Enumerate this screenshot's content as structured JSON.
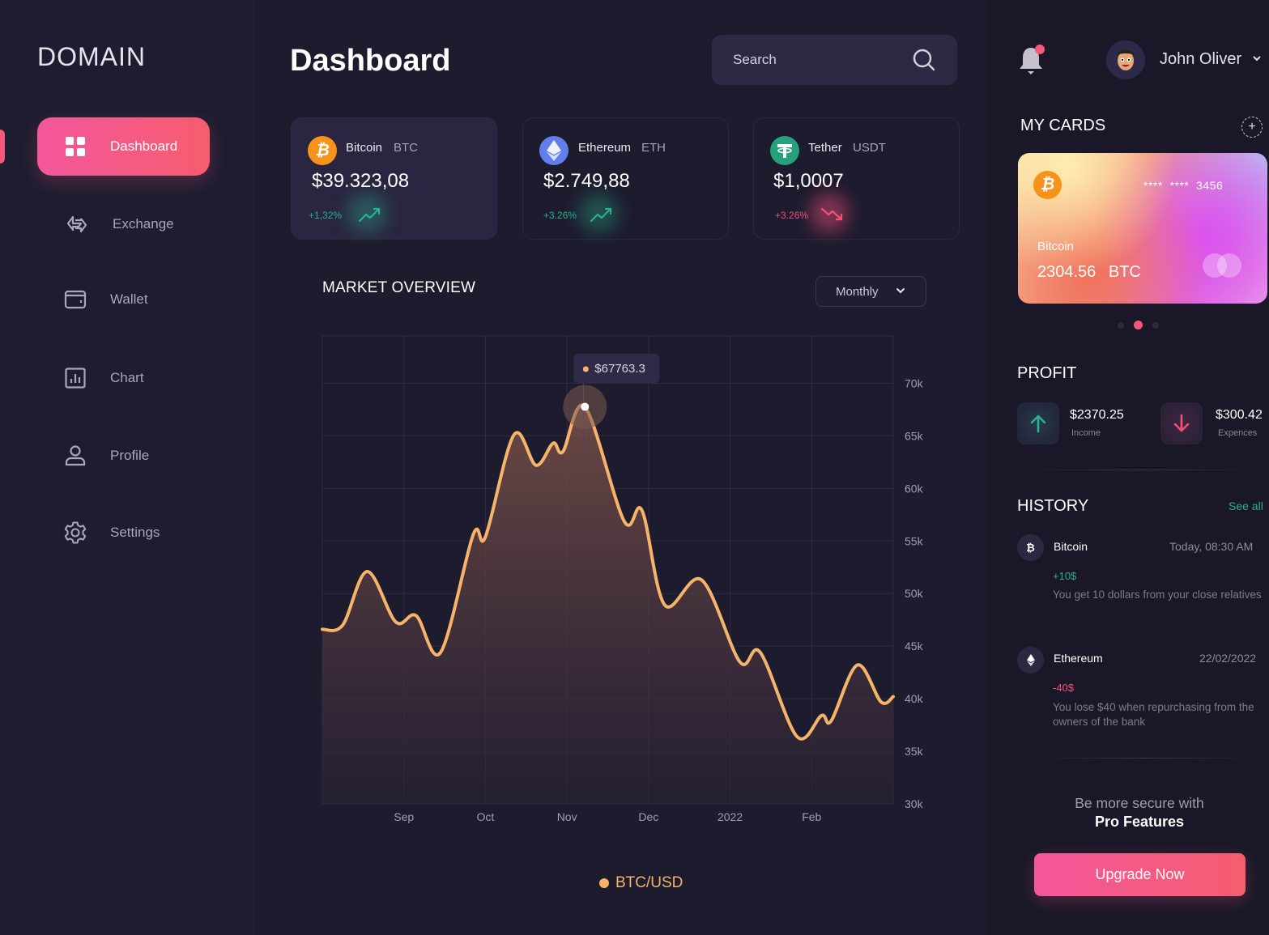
{
  "brand": {
    "logo_text": "DOMAIN"
  },
  "sidebar": {
    "items": [
      {
        "label": "Dashboard",
        "icon": "grid-icon",
        "active": true
      },
      {
        "label": "Exchange",
        "icon": "exchange-icon",
        "active": false
      },
      {
        "label": "Wallet",
        "icon": "wallet-icon",
        "active": false
      },
      {
        "label": "Chart",
        "icon": "bar-chart-icon",
        "active": false
      },
      {
        "label": "Profile",
        "icon": "user-icon",
        "active": false
      },
      {
        "label": "Settings",
        "icon": "gear-icon",
        "active": false
      }
    ]
  },
  "header": {
    "title": "Dashboard",
    "search_placeholder": "Search",
    "search_value": "",
    "notifications_unread": true,
    "user_name": "John Oliver"
  },
  "coins": [
    {
      "name": "Bitcoin",
      "symbol": "BTC",
      "price": "$39.323,08",
      "change": "+1,32%",
      "trend": "up",
      "icon": "bitcoin-icon",
      "color": "#f7931a"
    },
    {
      "name": "Ethereum",
      "symbol": "ETH",
      "price": "$2.749,88",
      "change": "+3.26%",
      "trend": "up",
      "icon": "ethereum-icon",
      "color": "#627eea"
    },
    {
      "name": "Tether",
      "symbol": "USDT",
      "price": "$1,0007",
      "change": "+3.26%",
      "trend": "down",
      "icon": "tether-icon",
      "color": "#26a17b"
    }
  ],
  "market": {
    "title": "MARKET OVERVIEW",
    "period": "Monthly",
    "tooltip": "$67763.3",
    "legend": "BTC/USD"
  },
  "chart_data": {
    "type": "area",
    "title": "MARKET OVERVIEW",
    "series": [
      {
        "name": "BTC/USD",
        "color": "#f5b46a",
        "points": [
          [
            0.0,
            46.6
          ],
          [
            0.25,
            47.0
          ],
          [
            0.55,
            52.1
          ],
          [
            0.9,
            47.3
          ],
          [
            1.15,
            47.9
          ],
          [
            1.45,
            44.4
          ],
          [
            1.85,
            55.6
          ],
          [
            2.0,
            55.4
          ],
          [
            2.35,
            65.1
          ],
          [
            2.62,
            62.2
          ],
          [
            2.83,
            64.3
          ],
          [
            2.95,
            63.5
          ],
          [
            3.22,
            67.76
          ],
          [
            3.7,
            56.9
          ],
          [
            3.92,
            57.9
          ],
          [
            4.2,
            48.9
          ],
          [
            4.65,
            51.3
          ],
          [
            5.12,
            43.5
          ],
          [
            5.37,
            44.4
          ],
          [
            5.82,
            36.4
          ],
          [
            6.12,
            38.4
          ],
          [
            6.24,
            37.9
          ],
          [
            6.56,
            43.2
          ],
          [
            6.85,
            39.7
          ],
          [
            7.0,
            40.2
          ]
        ]
      }
    ],
    "x_ticks": [
      "Sep",
      "Oct",
      "Nov",
      "Dec",
      "2022",
      "Feb"
    ],
    "x_tick_positions": [
      1,
      2,
      3,
      4,
      5,
      6
    ],
    "x_range": [
      0,
      7
    ],
    "y_ticks": [
      "30k",
      "35k",
      "40k",
      "45k",
      "50k",
      "55k",
      "60k",
      "65k",
      "70k"
    ],
    "y_tick_values": [
      30,
      35,
      40,
      45,
      50,
      55,
      60,
      65,
      70
    ],
    "ylim": [
      30,
      74.5
    ],
    "y_unit": "thousand USD",
    "grid": true,
    "legend": "bottom-center",
    "highlight": {
      "x": 3.22,
      "y": 67.76,
      "label": "$67763.3"
    }
  },
  "my_cards": {
    "title": "MY CARDS",
    "card": {
      "number_masked": "****  ****  3456",
      "coin": "Bitcoin",
      "balance": "2304.56",
      "unit": "BTC"
    },
    "pager": {
      "count": 3,
      "active": 1
    }
  },
  "profit": {
    "title": "PROFIT",
    "income": {
      "value": "$2370.25",
      "label": "Income"
    },
    "expenses": {
      "value": "$300.42",
      "label": "Expences"
    }
  },
  "history": {
    "title": "HISTORY",
    "see_all": "See all",
    "items": [
      {
        "coin": "Bitcoin",
        "date": "Today, 08:30 AM",
        "amount": "+10$",
        "positive": true,
        "description": "You get 10 dollars from your close relatives"
      },
      {
        "coin": "Ethereum",
        "date": "22/02/2022",
        "amount": "-40$",
        "positive": false,
        "description": "You lose $40 when repurchasing from the owners of the bank"
      }
    ]
  },
  "promo": {
    "line1": "Be more secure with",
    "line2": "Pro Features",
    "button": "Upgrade Now"
  },
  "colors": {
    "accent": "#f5587a",
    "positive": "#27b28f",
    "negative": "#f2507a",
    "chart_line": "#f5b46a",
    "background": "#1d1b2e"
  }
}
